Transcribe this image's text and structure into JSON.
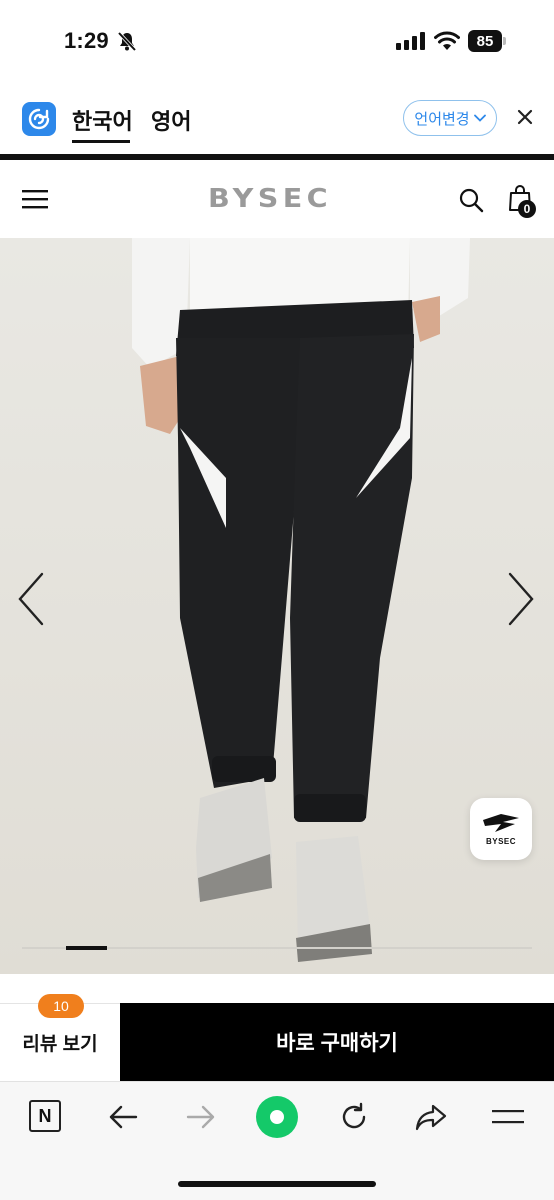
{
  "status_bar": {
    "time": "1:29",
    "battery_level": "85"
  },
  "translate_bar": {
    "lang_current": "한국어",
    "lang_other": "영어",
    "change_label": "언어변경",
    "brand_color": "#2d88ea"
  },
  "shop_header": {
    "brand": "BYSEC",
    "cart_count": "0"
  },
  "product_gallery": {
    "badge_text": "BYSEC",
    "slide_progress": 0.09,
    "background_color": "#e7e5df"
  },
  "purchase_bar": {
    "review_count": "10",
    "review_label": "리뷰 보기",
    "buy_label": "바로 구매하기",
    "review_badge_color": "#f07f1d"
  },
  "browser_toolbar": {
    "icons": [
      "naver-n-icon",
      "back-arrow-icon",
      "forward-arrow-icon",
      "home-icon",
      "reload-icon",
      "share-icon",
      "menu-icon"
    ],
    "naver_letter": "N",
    "home_color": "#14c969"
  }
}
